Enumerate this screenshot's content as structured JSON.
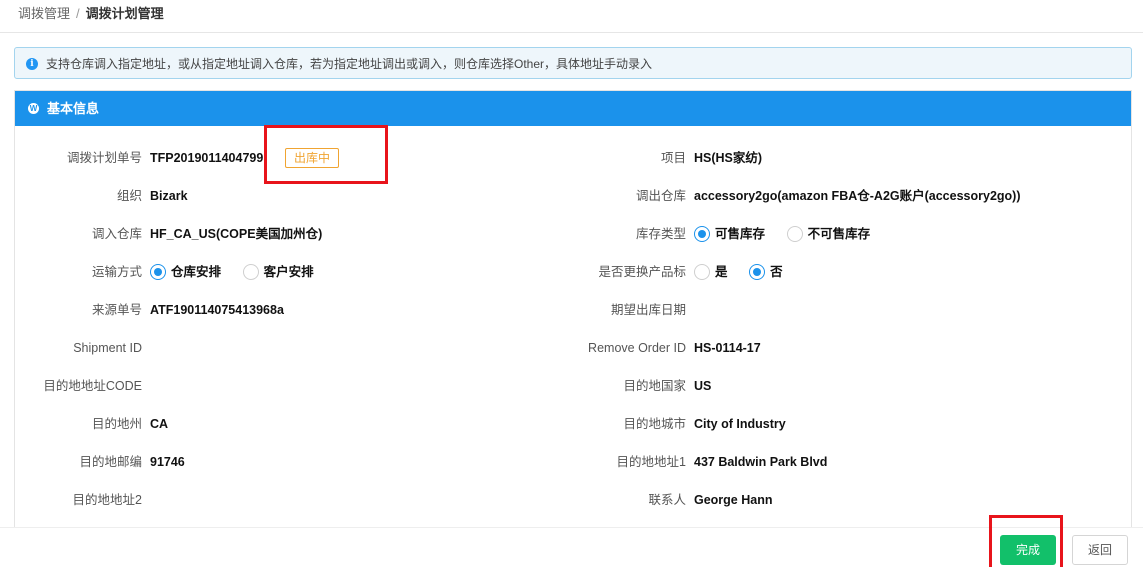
{
  "breadcrumb": {
    "parent": "调拨管理",
    "separator": "/",
    "current": "调拨计划管理"
  },
  "alert": {
    "icon": "info-icon",
    "text": "支持仓库调入指定地址，或从指定地址调入仓库，若为指定地址调出或调入，则仓库选择Other，具体地址手动录入"
  },
  "panel": {
    "icon": "wordpress-icon",
    "title": "基本信息"
  },
  "fields": {
    "plan_no_label": "调拨计划单号",
    "plan_no": "TFP2019011404799",
    "status": "出库中",
    "project_label": "项目",
    "project": "HS(HS家纺)",
    "org_label": "组织",
    "org": "Bizark",
    "out_wh_label": "调出仓库",
    "out_wh": "accessory2go(amazon FBA仓-A2G账户(accessory2go))",
    "in_wh_label": "调入仓库",
    "in_wh": "HF_CA_US(COPE美国加州仓)",
    "stock_type_label": "库存类型",
    "stock_type_opt1": "可售库存",
    "stock_type_opt2": "不可售库存",
    "transport_label": "运输方式",
    "transport_opt1": "仓库安排",
    "transport_opt2": "客户安排",
    "replace_label": "是否更换产品标",
    "replace_opt1": "是",
    "replace_opt2": "否",
    "source_label": "来源单号",
    "source": "ATF190114075413968a",
    "expect_date_label": "期望出库日期",
    "expect_date": "",
    "shipment_label": "Shipment ID",
    "shipment": "",
    "remove_label": "Remove Order ID",
    "remove": "HS-0114-17",
    "dest_code_label": "目的地地址CODE",
    "dest_code": "",
    "dest_country_label": "目的地国家",
    "dest_country": "US",
    "dest_state_label": "目的地州",
    "dest_state": "CA",
    "dest_city_label": "目的地城市",
    "dest_city": "City of Industry",
    "dest_zip_label": "目的地邮编",
    "dest_zip": "91746",
    "dest_addr1_label": "目的地地址1",
    "dest_addr1": "437 Baldwin Park Blvd",
    "dest_addr2_label": "目的地地址2",
    "dest_addr2": "",
    "contact_label": "联系人",
    "contact": "George Hann"
  },
  "footer": {
    "finish_label": "完成",
    "back_label": "返回"
  },
  "colors": {
    "primary": "#1b92eb",
    "success": "#12c06a",
    "warning": "#f0a431",
    "highlight": "#e8141b"
  }
}
